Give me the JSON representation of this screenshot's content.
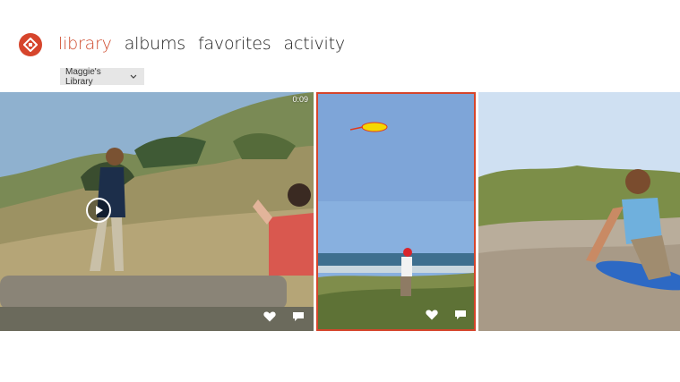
{
  "app": {
    "logo_icon": "revel-logo-icon",
    "brand_color": "#d6452c"
  },
  "nav": {
    "items": [
      {
        "label": "library",
        "active": true
      },
      {
        "label": "albums",
        "active": false
      },
      {
        "label": "favorites",
        "active": false
      },
      {
        "label": "activity",
        "active": false
      }
    ]
  },
  "library_select": {
    "value": "Maggie's Library",
    "icon": "chevron-down-icon"
  },
  "photos": [
    {
      "kind": "video",
      "duration": "0:09",
      "icons": [
        "play-icon",
        "heart-icon",
        "comment-icon"
      ]
    },
    {
      "kind": "photo",
      "selected": true,
      "icons": [
        "heart-icon",
        "comment-icon"
      ]
    },
    {
      "kind": "photo",
      "selected": false,
      "icons": []
    }
  ]
}
